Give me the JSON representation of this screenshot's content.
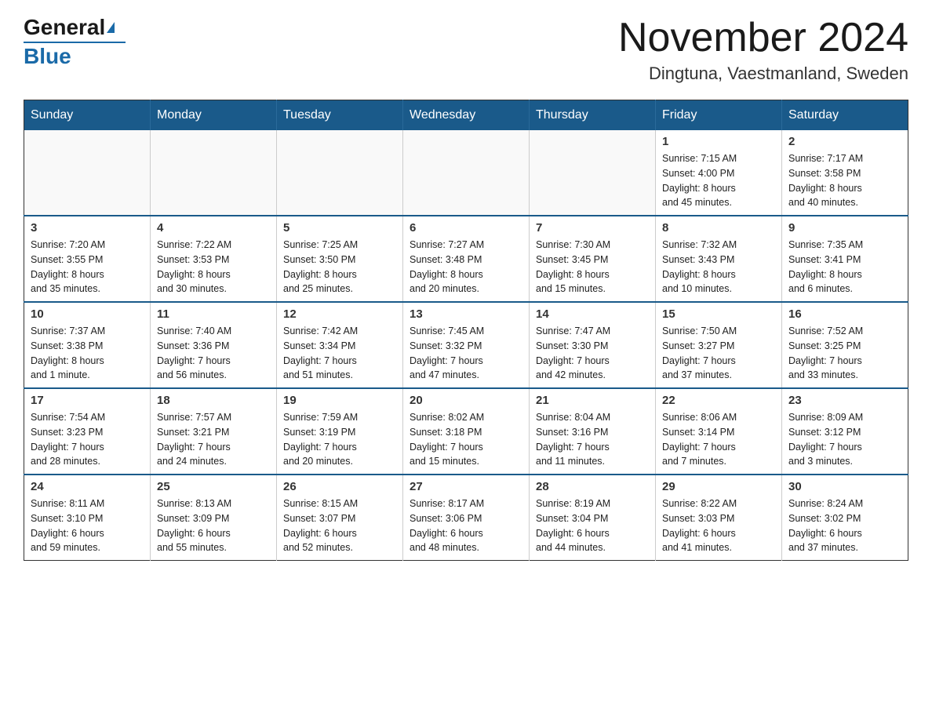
{
  "header": {
    "logo": {
      "general": "General",
      "blue": "Blue"
    },
    "title": "November 2024",
    "subtitle": "Dingtuna, Vaestmanland, Sweden"
  },
  "weekdays": [
    "Sunday",
    "Monday",
    "Tuesday",
    "Wednesday",
    "Thursday",
    "Friday",
    "Saturday"
  ],
  "weeks": [
    [
      {
        "day": "",
        "info": ""
      },
      {
        "day": "",
        "info": ""
      },
      {
        "day": "",
        "info": ""
      },
      {
        "day": "",
        "info": ""
      },
      {
        "day": "",
        "info": ""
      },
      {
        "day": "1",
        "info": "Sunrise: 7:15 AM\nSunset: 4:00 PM\nDaylight: 8 hours\nand 45 minutes."
      },
      {
        "day": "2",
        "info": "Sunrise: 7:17 AM\nSunset: 3:58 PM\nDaylight: 8 hours\nand 40 minutes."
      }
    ],
    [
      {
        "day": "3",
        "info": "Sunrise: 7:20 AM\nSunset: 3:55 PM\nDaylight: 8 hours\nand 35 minutes."
      },
      {
        "day": "4",
        "info": "Sunrise: 7:22 AM\nSunset: 3:53 PM\nDaylight: 8 hours\nand 30 minutes."
      },
      {
        "day": "5",
        "info": "Sunrise: 7:25 AM\nSunset: 3:50 PM\nDaylight: 8 hours\nand 25 minutes."
      },
      {
        "day": "6",
        "info": "Sunrise: 7:27 AM\nSunset: 3:48 PM\nDaylight: 8 hours\nand 20 minutes."
      },
      {
        "day": "7",
        "info": "Sunrise: 7:30 AM\nSunset: 3:45 PM\nDaylight: 8 hours\nand 15 minutes."
      },
      {
        "day": "8",
        "info": "Sunrise: 7:32 AM\nSunset: 3:43 PM\nDaylight: 8 hours\nand 10 minutes."
      },
      {
        "day": "9",
        "info": "Sunrise: 7:35 AM\nSunset: 3:41 PM\nDaylight: 8 hours\nand 6 minutes."
      }
    ],
    [
      {
        "day": "10",
        "info": "Sunrise: 7:37 AM\nSunset: 3:38 PM\nDaylight: 8 hours\nand 1 minute."
      },
      {
        "day": "11",
        "info": "Sunrise: 7:40 AM\nSunset: 3:36 PM\nDaylight: 7 hours\nand 56 minutes."
      },
      {
        "day": "12",
        "info": "Sunrise: 7:42 AM\nSunset: 3:34 PM\nDaylight: 7 hours\nand 51 minutes."
      },
      {
        "day": "13",
        "info": "Sunrise: 7:45 AM\nSunset: 3:32 PM\nDaylight: 7 hours\nand 47 minutes."
      },
      {
        "day": "14",
        "info": "Sunrise: 7:47 AM\nSunset: 3:30 PM\nDaylight: 7 hours\nand 42 minutes."
      },
      {
        "day": "15",
        "info": "Sunrise: 7:50 AM\nSunset: 3:27 PM\nDaylight: 7 hours\nand 37 minutes."
      },
      {
        "day": "16",
        "info": "Sunrise: 7:52 AM\nSunset: 3:25 PM\nDaylight: 7 hours\nand 33 minutes."
      }
    ],
    [
      {
        "day": "17",
        "info": "Sunrise: 7:54 AM\nSunset: 3:23 PM\nDaylight: 7 hours\nand 28 minutes."
      },
      {
        "day": "18",
        "info": "Sunrise: 7:57 AM\nSunset: 3:21 PM\nDaylight: 7 hours\nand 24 minutes."
      },
      {
        "day": "19",
        "info": "Sunrise: 7:59 AM\nSunset: 3:19 PM\nDaylight: 7 hours\nand 20 minutes."
      },
      {
        "day": "20",
        "info": "Sunrise: 8:02 AM\nSunset: 3:18 PM\nDaylight: 7 hours\nand 15 minutes."
      },
      {
        "day": "21",
        "info": "Sunrise: 8:04 AM\nSunset: 3:16 PM\nDaylight: 7 hours\nand 11 minutes."
      },
      {
        "day": "22",
        "info": "Sunrise: 8:06 AM\nSunset: 3:14 PM\nDaylight: 7 hours\nand 7 minutes."
      },
      {
        "day": "23",
        "info": "Sunrise: 8:09 AM\nSunset: 3:12 PM\nDaylight: 7 hours\nand 3 minutes."
      }
    ],
    [
      {
        "day": "24",
        "info": "Sunrise: 8:11 AM\nSunset: 3:10 PM\nDaylight: 6 hours\nand 59 minutes."
      },
      {
        "day": "25",
        "info": "Sunrise: 8:13 AM\nSunset: 3:09 PM\nDaylight: 6 hours\nand 55 minutes."
      },
      {
        "day": "26",
        "info": "Sunrise: 8:15 AM\nSunset: 3:07 PM\nDaylight: 6 hours\nand 52 minutes."
      },
      {
        "day": "27",
        "info": "Sunrise: 8:17 AM\nSunset: 3:06 PM\nDaylight: 6 hours\nand 48 minutes."
      },
      {
        "day": "28",
        "info": "Sunrise: 8:19 AM\nSunset: 3:04 PM\nDaylight: 6 hours\nand 44 minutes."
      },
      {
        "day": "29",
        "info": "Sunrise: 8:22 AM\nSunset: 3:03 PM\nDaylight: 6 hours\nand 41 minutes."
      },
      {
        "day": "30",
        "info": "Sunrise: 8:24 AM\nSunset: 3:02 PM\nDaylight: 6 hours\nand 37 minutes."
      }
    ]
  ]
}
